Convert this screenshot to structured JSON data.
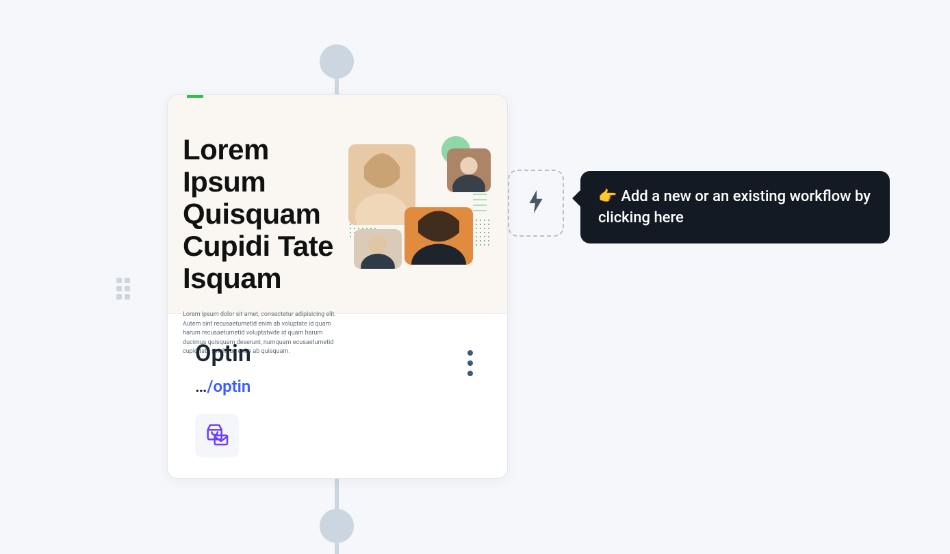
{
  "thumbnail": {
    "heading": "Lorem Ipsum Quisquam Cupidi Tate Isquam",
    "paragraph": "Lorem ipsum dolor sit amet, consectetur adipisicing elit. Autem sint recusaetumetid enim ab voluptate id quam harum recusaetumetid voluptatwde id quam harum ducimus quisquam deserunt, numquam ecusaetumetid cupiditate similique enim ab quisquam."
  },
  "card": {
    "title": "Optin",
    "pathPrefix": "…",
    "pathSlug": "/optin"
  },
  "tooltip": {
    "emoji": "👉",
    "text": "Add a new or an existing workflow by clicking here"
  }
}
